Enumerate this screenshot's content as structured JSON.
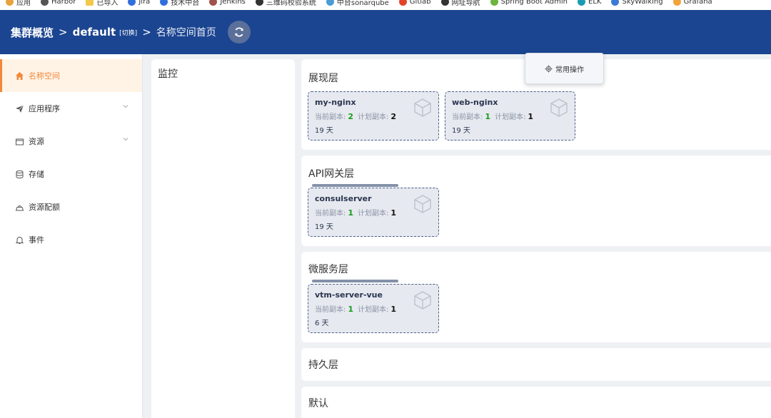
{
  "bookmarks": [
    {
      "label": "应用",
      "color": "#e8a33c",
      "icon": "apps-grid-icon"
    },
    {
      "label": "Harbor",
      "color": "#555555",
      "icon": "harbor-icon"
    },
    {
      "label": "已导入",
      "color": "#f2c84b",
      "icon": "folder-icon"
    },
    {
      "label": "Jira",
      "color": "#2f6fde",
      "icon": "jira-icon"
    },
    {
      "label": "技术中台",
      "color": "#2f6fde",
      "icon": "tech-platform-icon"
    },
    {
      "label": "Jenkins",
      "color": "#a0524a",
      "icon": "jenkins-icon"
    },
    {
      "label": "三维码校验系统",
      "color": "#333333",
      "icon": "verification-system-icon"
    },
    {
      "label": "中台sonarqube",
      "color": "#4a9bd6",
      "icon": "sonarqube-icon"
    },
    {
      "label": "Gitlab",
      "color": "#e2432a",
      "icon": "gitlab-icon"
    },
    {
      "label": "网址导航",
      "color": "#333333",
      "icon": "nav-site-icon"
    },
    {
      "label": "Spring Boot Admin",
      "color": "#6db33f",
      "icon": "spring-boot-icon"
    },
    {
      "label": "ELK",
      "color": "#1a9cb0",
      "icon": "elk-icon"
    },
    {
      "label": "SkyWalking",
      "color": "#3a7bd5",
      "icon": "skywalking-icon"
    },
    {
      "label": "Grafana",
      "color": "#f2a33a",
      "icon": "grafana-icon"
    }
  ],
  "header": {
    "cluster": "集群概览",
    "namespace": "default",
    "switch_label": "[切换]",
    "page": "名称空间首页",
    "separator": ">"
  },
  "sidebar": {
    "items": [
      {
        "label": "名称空间",
        "icon": "home-icon",
        "active": true
      },
      {
        "label": "应用程序",
        "icon": "paper-plane-icon",
        "expandable": true
      },
      {
        "label": "资源",
        "icon": "folder-icon",
        "expandable": true
      },
      {
        "label": "存储",
        "icon": "database-icon"
      },
      {
        "label": "资源配额",
        "icon": "quota-icon"
      },
      {
        "label": "事件",
        "icon": "bell-icon"
      }
    ]
  },
  "monitor": {
    "title": "监控"
  },
  "ops_popup": {
    "label": "常用操作",
    "icon": "gear-icon"
  },
  "replica_labels": {
    "current": "当前副本:",
    "planned": "计划副本:"
  },
  "layers": [
    {
      "title": "展现层",
      "cards": [
        {
          "name": "my-nginx",
          "current": "2",
          "planned": "2",
          "age": "19 天"
        },
        {
          "name": "web-nginx",
          "current": "1",
          "planned": "1",
          "age": "19 天"
        }
      ]
    },
    {
      "title": "API网关层",
      "cards": [
        {
          "name": "consulserver",
          "current": "1",
          "planned": "1",
          "age": "19 天"
        }
      ]
    },
    {
      "title": "微服务层",
      "cards": [
        {
          "name": "vtm-server-vue",
          "current": "1",
          "planned": "1",
          "age": "6 天"
        }
      ]
    },
    {
      "title": "持久层",
      "cards": []
    },
    {
      "title": "默认",
      "cards": []
    }
  ],
  "colors": {
    "header_bg": "#1b4591",
    "accent_orange": "#f0883a",
    "replica_current": "#1a9b1a",
    "card_border": "#4a5f8a"
  }
}
